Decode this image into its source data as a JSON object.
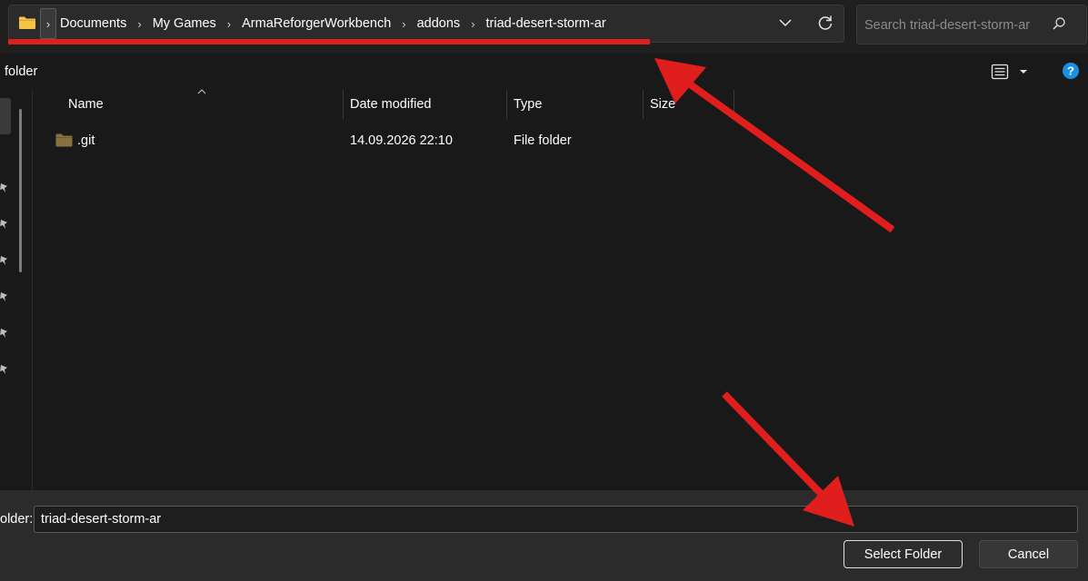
{
  "address_bar": {
    "breadcrumbs": [
      "Documents",
      "My Games",
      "ArmaReforgerWorkbench",
      "addons",
      "triad-desert-storm-ar"
    ],
    "separator_glyph": "›",
    "expander_glyph": "›"
  },
  "search": {
    "placeholder": "Search triad-desert-storm-ar"
  },
  "command_bar": {
    "label": "folder"
  },
  "columns": {
    "name": "Name",
    "date_modified": "Date modified",
    "type": "Type",
    "size": "Size"
  },
  "files": [
    {
      "name": ".git",
      "date_modified": "14.09.2026 22:10",
      "type": "File folder",
      "size": ""
    }
  ],
  "footer": {
    "folder_label": "older:",
    "folder_value": "triad-desert-storm-ar",
    "select_button": "Select Folder",
    "cancel_button": "Cancel"
  },
  "icons": {
    "folder": "folder-icon",
    "refresh": "refresh-icon",
    "search": "search-icon",
    "help": "help-icon",
    "view": "details-view-icon"
  },
  "colors": {
    "background": "#191919",
    "surface": "#2b2b2b",
    "folder_yellow": "#f3c447",
    "folder_dark": "#8a7040",
    "help_blue": "#1a8fe3",
    "annotation_red": "#e01e1e"
  }
}
